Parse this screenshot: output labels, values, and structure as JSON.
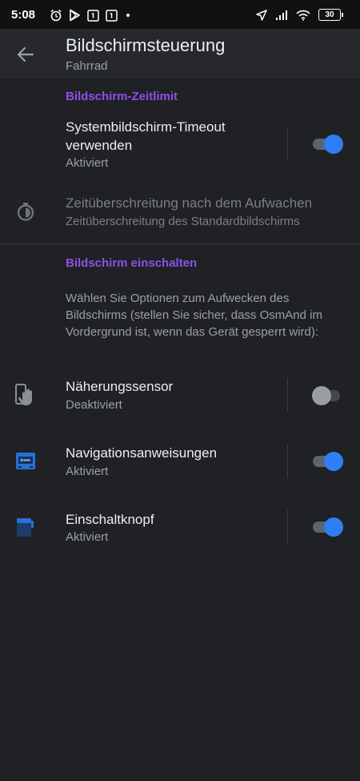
{
  "status_bar": {
    "time": "5:08",
    "battery": "30"
  },
  "toolbar": {
    "title": "Bildschirmsteuerung",
    "subtitle": "Fahrrad"
  },
  "sections": {
    "screen_timeout": {
      "header": "Bildschirm-Zeitlimit",
      "system_timeout": {
        "title": "Systembildschirm-Timeout verwenden",
        "status": "Aktiviert",
        "enabled": true
      },
      "wake_timeout": {
        "title": "Zeitüberschreitung nach dem Aufwachen",
        "subtitle": "Zeitüberschreitung des Standardbildschirms"
      }
    },
    "turn_screen_on": {
      "header": "Bildschirm einschalten",
      "description": "Wählen Sie Optionen zum Aufwecken des Bildschirms (stellen Sie sicher, dass OsmAnd im Vordergrund ist, wenn das Gerät gesperrt wird):",
      "items": [
        {
          "title": "Näherungssensor",
          "status": "Deaktiviert",
          "enabled": false,
          "icon": "proximity-hand-icon"
        },
        {
          "title": "Navigationsanweisungen",
          "status": "Aktiviert",
          "enabled": true,
          "icon": "navigation-instructions-icon"
        },
        {
          "title": "Einschaltknopf",
          "status": "Aktiviert",
          "enabled": true,
          "icon": "power-button-icon"
        }
      ]
    }
  },
  "colors": {
    "accent_purple": "#8c4fe8",
    "toggle_on": "#2f7ef5",
    "icon_blue": "#2a6fd6",
    "background": "#202124"
  }
}
